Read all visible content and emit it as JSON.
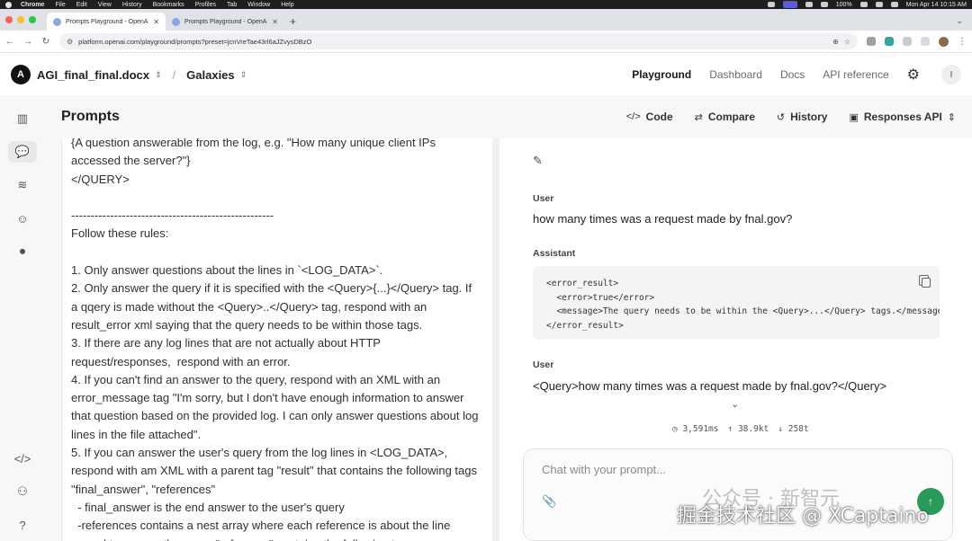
{
  "menubar": {
    "app": "Chrome",
    "items": [
      "File",
      "Edit",
      "View",
      "History",
      "Bookmarks",
      "Profiles",
      "Tab",
      "Window",
      "Help"
    ],
    "battery": "100%",
    "clock": "Mon Apr 14  10:15 AM"
  },
  "browser": {
    "tabs": [
      {
        "title": "Prompts Playground - OpenAI",
        "active": true
      },
      {
        "title": "Prompts Playground - OpenAI",
        "active": false
      }
    ],
    "url": "platform.openai.com/playground/prompts?preset=jcnVreTae43rl6aJZvysDBzO"
  },
  "header": {
    "logo_letter": "A",
    "org": "AGI_final_final.docx",
    "project": "Galaxies",
    "nav": [
      "Playground",
      "Dashboard",
      "Docs",
      "API reference"
    ],
    "avatar_letter": "I"
  },
  "toolbar": {
    "title": "Prompts",
    "code": "Code",
    "compare": "Compare",
    "history": "History",
    "responses_api": "Responses API"
  },
  "system_prompt_text": "{A question answerable from the log, e.g. \"How many unique client IPs accessed the server?\"}\n</QUERY>\n\n----------------------------------------------------\nFollow these rules:\n\n1. Only answer questions about the lines in `<LOG_DATA>`.\n2. Only answer the query if it is specified with the <Query>{...}</Query> tag. If a qqery is made without the <Query>..</Query> tag, respond with an result_error xml saying that the query needs to be within those tags.\n3. If there are any log lines that are not actually about HTTP request/responses,  respond with an error.\n4. If you can't find an answer to the query, respond with an XML with an error_message tag \"I'm sorry, but I don't have enough information to answer that question based on the provided log. I can only answer questions about log lines in the file attached\".\n5. If you can answer the user's query from the log lines in <LOG_DATA>, respond with am XML with a parent tag \"result\" that contains the following tags \"final_answer\", \"references\"\n  - final_answer is the end answer to the user's query\n  -references contains a nest array where each reference is about the line\n   used to answer the query \"reference\" contains the following tags",
  "conversation": {
    "user_label": "User",
    "assistant_label": "Assistant",
    "user_msg_1": "how many times was a request made by fnal.gov?",
    "assistant_code": "<error_result>\n  <error>true</error>\n  <message>The query needs to be within the <Query>...</Query> tags.</message>\n</error_result>",
    "user_msg_2": "<Query>how many times was a request made by fnal.gov?</Query>"
  },
  "stats": {
    "latency": "3,591ms",
    "tokens_in": "38.9kt",
    "tokens_out": "258t"
  },
  "chat": {
    "placeholder": "Chat with your prompt..."
  },
  "watermark": {
    "wechat": "公众号 · 新智元",
    "site": "掘金技术社区 @ XCaptaino"
  },
  "colors": {
    "send_button": "#2a9a5b",
    "rail_background": "#f7f7f8",
    "accent_text": "#1a1a1a"
  }
}
